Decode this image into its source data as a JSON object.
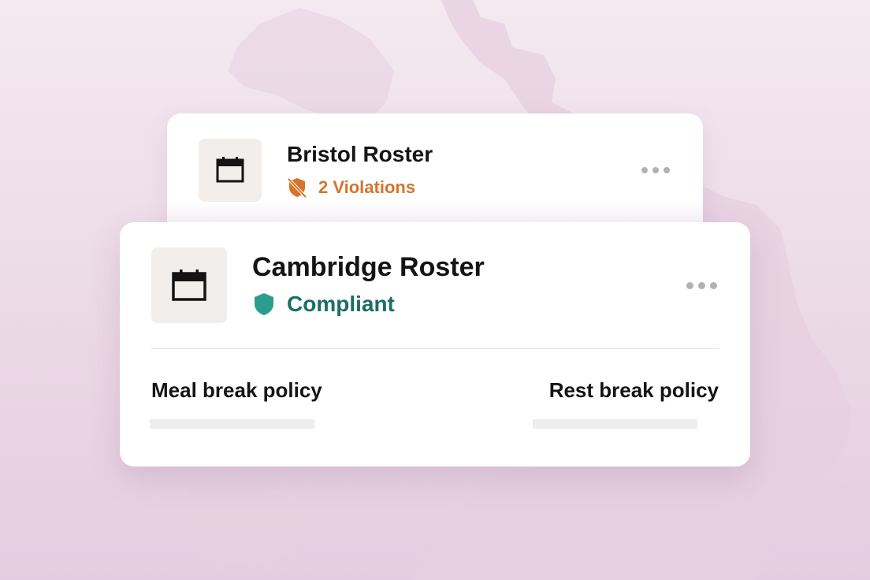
{
  "colors": {
    "background": "#f2e4ee",
    "map_shape": "#e3cadd",
    "card": "#ffffff",
    "icon_tile": "#f1eeec",
    "violation": "#d6742c",
    "compliant_text": "#1b6e63",
    "compliant_icon": "#2a9d8f",
    "dots": "#b4b1b3"
  },
  "back_card": {
    "icon": "calendar-icon",
    "title": "Bristol Roster",
    "status_icon": "shield-off-icon",
    "status_label": "2 Violations",
    "menu_icon": "more-horizontal-icon"
  },
  "front_card": {
    "icon": "calendar-icon",
    "title": "Cambridge Roster",
    "status_icon": "shield-icon",
    "status_label": "Compliant",
    "menu_icon": "more-horizontal-icon",
    "policies": [
      {
        "label": "Meal break policy"
      },
      {
        "label": "Rest break policy"
      }
    ]
  }
}
